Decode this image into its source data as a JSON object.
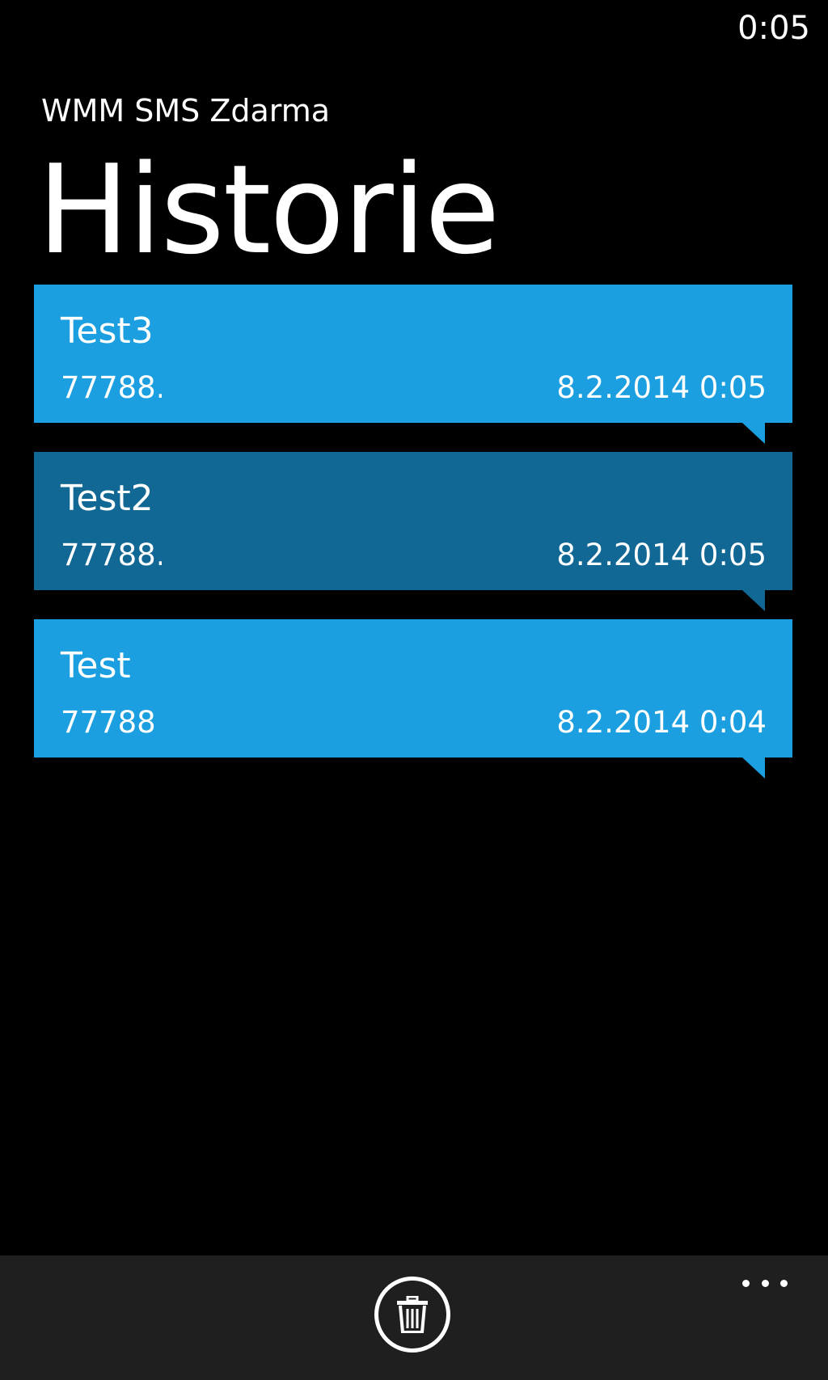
{
  "status_bar": {
    "time": "0:05"
  },
  "header": {
    "app_title": "WMM SMS Zdarma",
    "page_title": "Historie"
  },
  "history": {
    "items": [
      {
        "name": "Test3",
        "number": "77788...",
        "date": "8.2.2014 0:05",
        "selected": false
      },
      {
        "name": "Test2",
        "number": "77788...",
        "date": "8.2.2014 0:05",
        "selected": true
      },
      {
        "name": "Test",
        "number": "77788",
        "date": "8.2.2014 0:04",
        "selected": false
      }
    ]
  },
  "app_bar": {
    "delete_icon": "trash-icon",
    "more_icon": "ellipsis-icon"
  },
  "colors": {
    "accent": "#1b9fe0",
    "selected": "#116895",
    "app_bar": "#1f1f1f",
    "background": "#000000"
  }
}
